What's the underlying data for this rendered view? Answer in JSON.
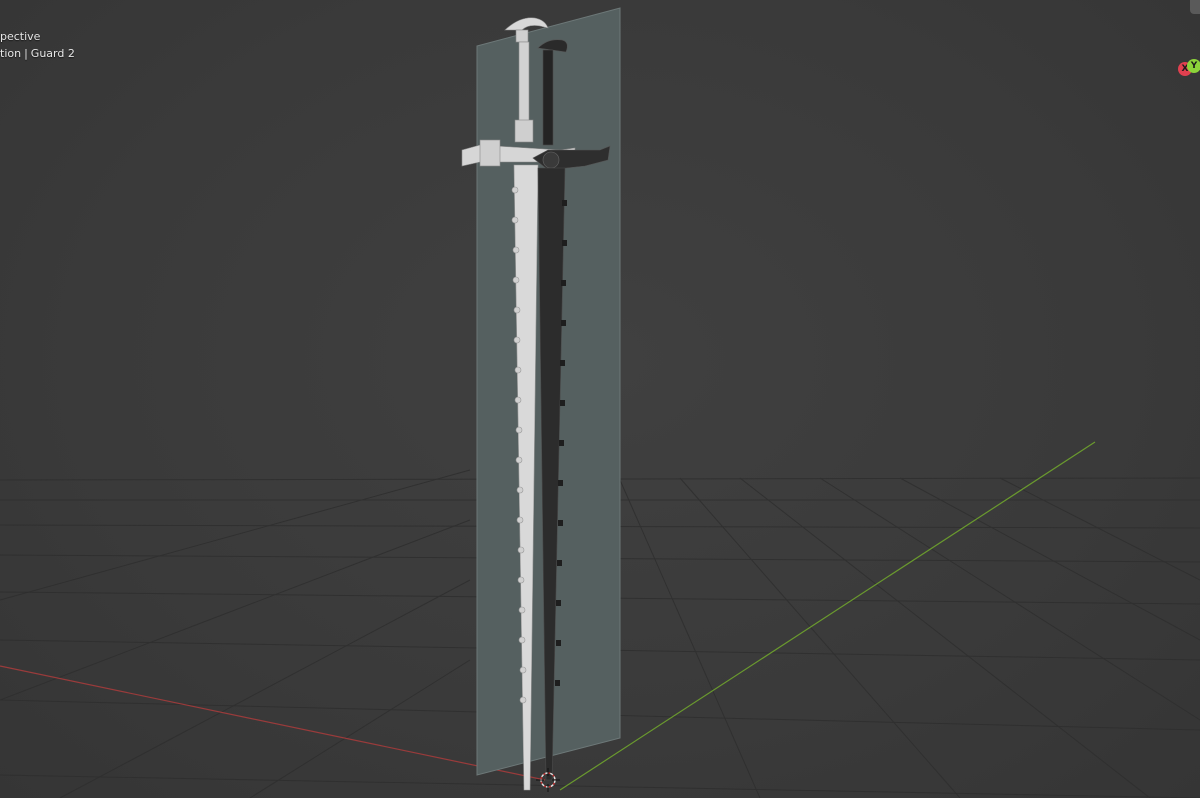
{
  "viewport": {
    "view_mode": "pective",
    "collection": "tion",
    "object": "Guard 2"
  },
  "gizmo": {
    "x_label": "X",
    "y_label": "Y",
    "x_color": "#e0404f",
    "y_color": "#8cd33a"
  },
  "colors": {
    "background": "#3a3a3a",
    "grid": "#2f2f2f",
    "x_axis": "#9a3b3b",
    "y_axis": "#6a9a2e",
    "reference_plane": "#556060",
    "light_sword": "#d8d8d8",
    "dark_sword": "#2a2a2a"
  },
  "icons": [
    "3d-cursor-icon",
    "axis-gizmo-icon"
  ]
}
